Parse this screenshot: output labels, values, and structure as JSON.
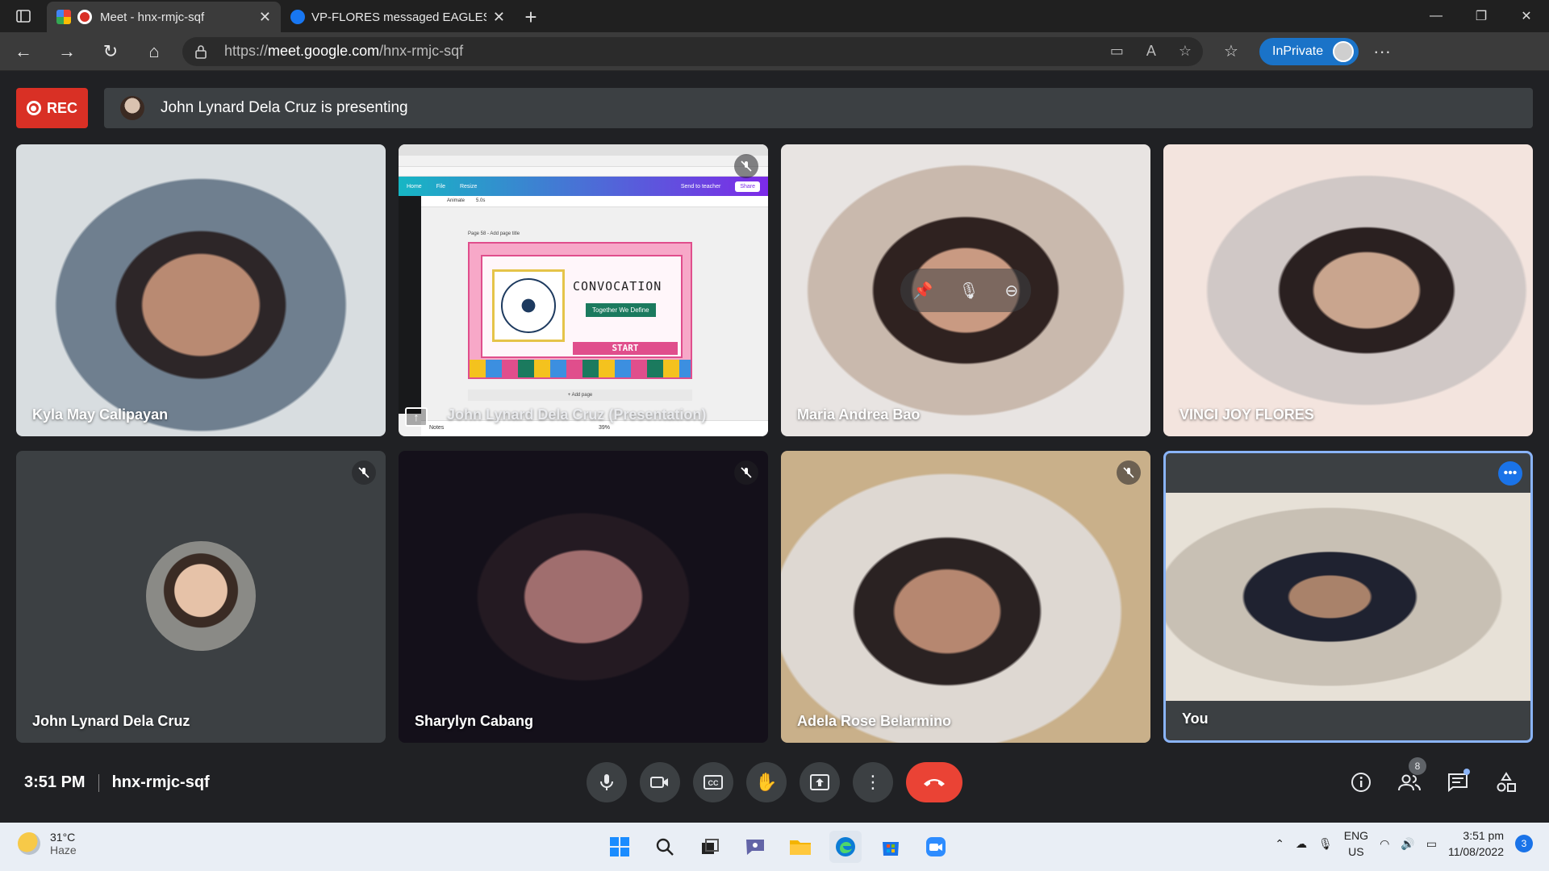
{
  "browser": {
    "tabs": [
      {
        "title": "Meet - hnx-rmjc-sqf",
        "active": true
      },
      {
        "title": "VP-FLORES messaged EAGLES C",
        "active": false
      }
    ],
    "url_prefix": "https://",
    "url_host": "meet.google.com",
    "url_path": "/hnx-rmjc-sqf",
    "inprivate_label": "InPrivate"
  },
  "meet": {
    "rec_label": "REC",
    "presenting_text": "John Lynard Dela Cruz is presenting",
    "tiles": [
      {
        "name": "Kyla May Calipayan",
        "muted": false
      },
      {
        "name": "John Lynard Dela Cruz (Presentation)",
        "muted": true
      },
      {
        "name": "Maria Andrea Bao",
        "muted": false
      },
      {
        "name": "VINCI JOY FLORES",
        "muted": false
      },
      {
        "name": "John Lynard Dela Cruz",
        "muted": true
      },
      {
        "name": "Sharylyn Cabang",
        "muted": true
      },
      {
        "name": "Adela Rose Belarmino",
        "muted": true
      },
      {
        "name": "You",
        "muted": false
      }
    ],
    "slide": {
      "page_label": "Page 58 - Add page title",
      "title": "CONVOCATION",
      "subtitle": "Together We Define",
      "start_label": "START",
      "add_page": "+ Add page",
      "notes": "Notes",
      "zoom": "39%",
      "canva_nav": [
        "Home",
        "File",
        "Resize"
      ],
      "send_label": "Send to teacher",
      "share_label": "Share",
      "animate_label": "Animate",
      "duration_label": "5.0s"
    },
    "bottom": {
      "time": "3:51 PM",
      "meeting_code": "hnx-rmjc-sqf",
      "participant_count": "8"
    },
    "colors": {
      "accent": "#8ab4f8",
      "end_call": "#ea4335",
      "rec": "#d93025"
    }
  },
  "taskbar": {
    "temperature": "31°C",
    "weather": "Haze",
    "lang_top": "ENG",
    "lang_bottom": "US",
    "time": "3:51 pm",
    "date": "11/08/2022",
    "notifications": "3"
  }
}
